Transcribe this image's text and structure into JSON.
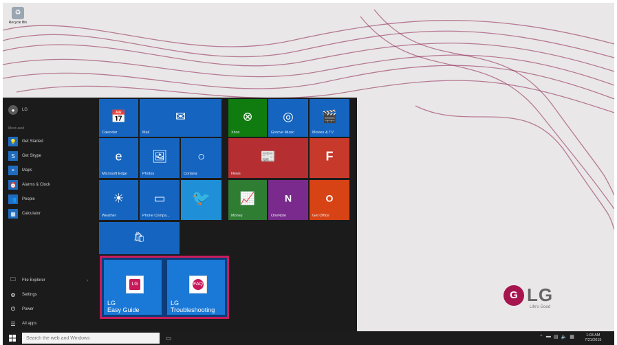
{
  "desktop": {
    "recycle_bin_label": "Recycle Bin",
    "lg_logo_text": "LG",
    "lg_tagline": "Life's Good"
  },
  "start_menu": {
    "user_name": "LG",
    "most_used_label": "Most used",
    "most_used": [
      {
        "label": "Get Started",
        "icon": "lightbulb-icon"
      },
      {
        "label": "Get Skype",
        "icon": "skype-icon"
      },
      {
        "label": "Maps",
        "icon": "maps-icon"
      },
      {
        "label": "Alarms & Clock",
        "icon": "alarm-icon"
      },
      {
        "label": "People",
        "icon": "people-icon"
      },
      {
        "label": "Calculator",
        "icon": "calculator-icon"
      }
    ],
    "bottom": [
      {
        "label": "File Explorer",
        "icon": "folder-icon"
      },
      {
        "label": "Settings",
        "icon": "gear-icon"
      },
      {
        "label": "Power",
        "icon": "power-icon"
      },
      {
        "label": "All apps",
        "icon": "all-apps-icon"
      }
    ],
    "tiles": {
      "calendar": "Calendar",
      "mail": "Mail",
      "xbox": "Xbox",
      "groove": "Groove Music",
      "movies": "Movies & TV",
      "edge": "Microsoft Edge",
      "photos": "Photos",
      "cortana": "Cortana",
      "news": "News",
      "weather": "Weather",
      "phone": "Phone Compa...",
      "money": "Money",
      "onenote": "OneNote",
      "getoffice": "Get Office"
    },
    "lg_tiles": {
      "easy_guide_line1": "LG",
      "easy_guide_line2": "Easy Guide",
      "troubleshooting_line1": "LG",
      "troubleshooting_line2": "Troubleshooting"
    }
  },
  "taskbar": {
    "search_placeholder": "Search the web and Windows",
    "clock_time": "1:03 AM",
    "clock_date": "7/21/2015"
  },
  "colors": {
    "highlight_border": "#c81d5c",
    "tile_blue": "#1565c0",
    "xbox_green": "#107c10",
    "news_red": "#b52e31",
    "money_green": "#2f7d32",
    "onenote_purple": "#7a2a8c",
    "office_orange": "#d84315"
  }
}
